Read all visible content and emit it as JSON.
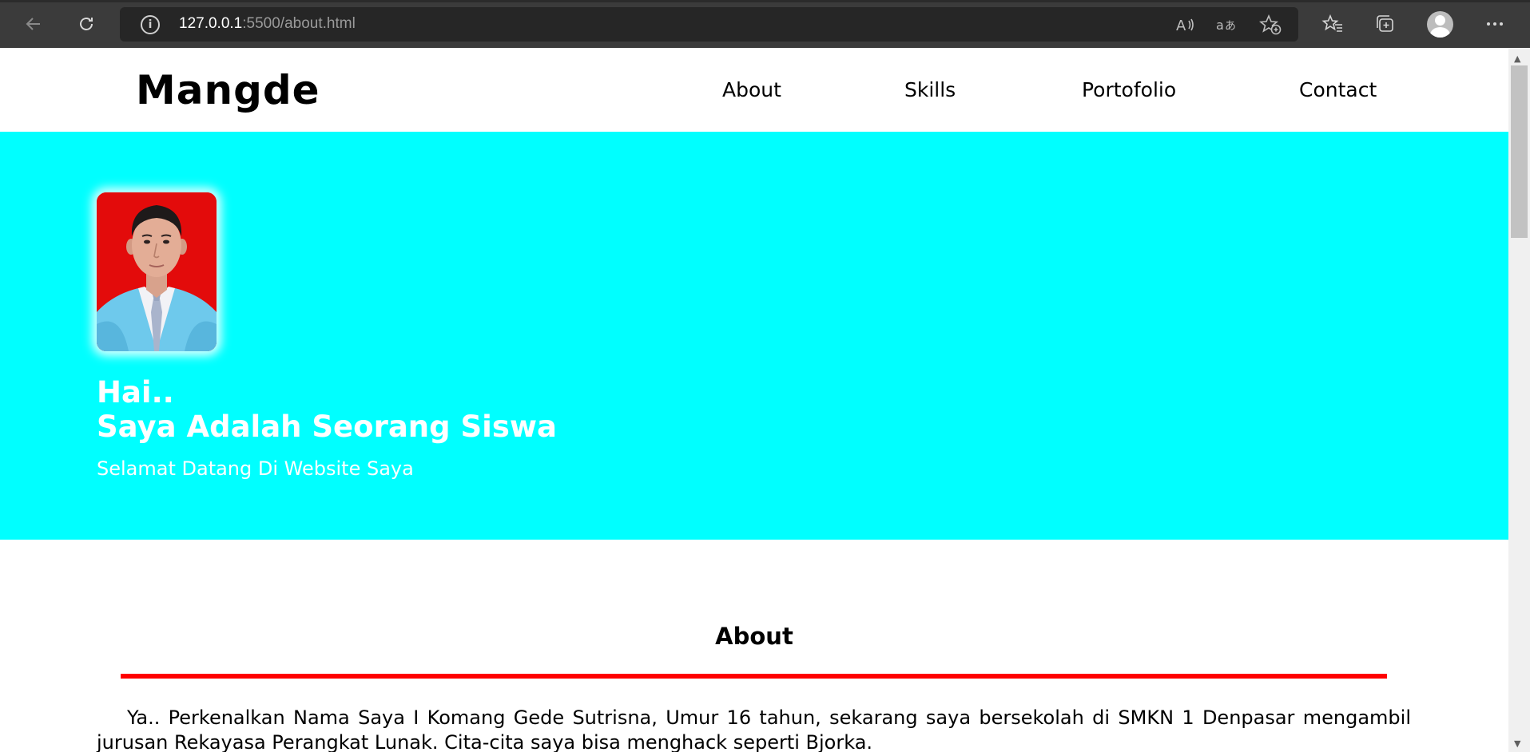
{
  "browser": {
    "url_host": "127.0.0.1",
    "url_rest": ":5500/about.html",
    "info_glyph": "i",
    "icons": [
      "back-arrow-icon",
      "reload-icon",
      "info-icon",
      "read-aloud-icon",
      "translate-icon",
      "add-favorite-icon",
      "favorites-icon",
      "collections-icon",
      "profile-icon",
      "more-icon"
    ]
  },
  "site": {
    "logo": "Mangde",
    "menu": [
      "About",
      "Skills",
      "Portofolio",
      "Contact"
    ]
  },
  "hero": {
    "greeting": "Hai..",
    "headline": "Saya Adalah Seorang Siswa",
    "subtitle": "Selamat Datang Di Website Saya",
    "background": "#00ffff"
  },
  "about": {
    "title": "About",
    "rule_color": "#ff0000",
    "text": "Ya.. Perkenalkan Nama Saya I Komang Gede Sutrisna, Umur 16 tahun, sekarang saya bersekolah di SMKN 1 Denpasar mengambil jurusan Rekayasa Perangkat Lunak. Cita-cita saya bisa menghack seperti Bjorka."
  }
}
